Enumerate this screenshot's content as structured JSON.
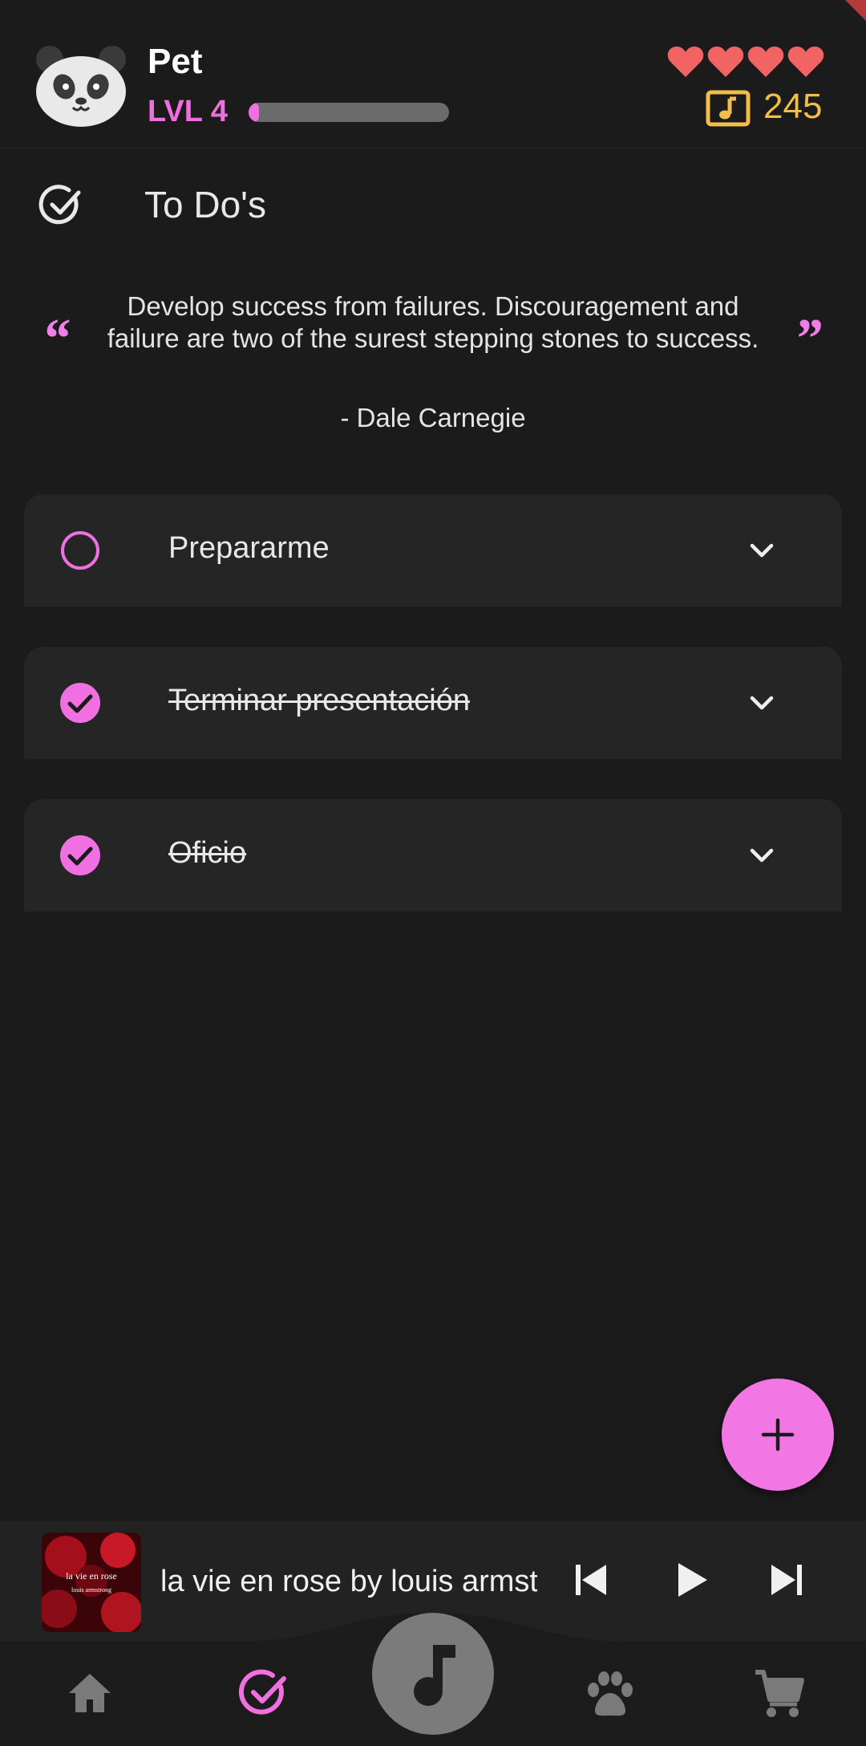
{
  "header": {
    "pet_name": "Pet",
    "level": "LVL 4",
    "xp_progress": 0.05,
    "hearts": 4,
    "coins": "245",
    "accent_color": "#f06ee0",
    "coin_color": "#f2be4a",
    "heart_color": "#f26363"
  },
  "section": {
    "title": "To Do's",
    "icon": "check-circle-icon"
  },
  "quote": {
    "text": "Develop success from failures. Discouragement and failure are two of the surest stepping stones to success.",
    "author": "- Dale Carnegie"
  },
  "tasks": [
    {
      "label": "Prepararme",
      "done": false
    },
    {
      "label": "Terminar presentación",
      "done": true
    },
    {
      "label": "Oficio",
      "done": true
    }
  ],
  "fab": {
    "icon": "plus-icon"
  },
  "player": {
    "track": "la vie en rose by louis armstrong",
    "album_art_text": "la vie en rose",
    "album_art_subtext": "louis armstrong"
  },
  "nav": {
    "items": [
      "home-icon",
      "todos-icon",
      "music-icon",
      "pet-paw-icon",
      "shop-cart-icon"
    ],
    "active": "todos-icon"
  }
}
